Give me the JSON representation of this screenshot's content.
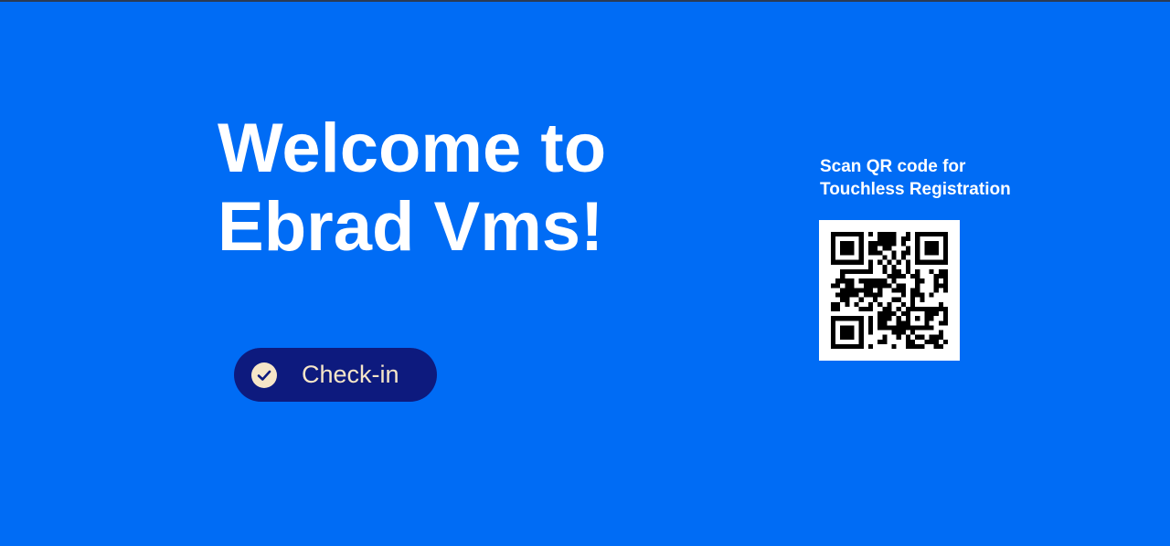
{
  "welcome": {
    "line1": "Welcome to",
    "line2": "Ebrad Vms!"
  },
  "checkin_button": {
    "label": "Check-in",
    "icon": "check-circle-icon"
  },
  "qr": {
    "caption_line1": "Scan QR code for",
    "caption_line2": "Touchless Registration",
    "icon": "qr-code"
  },
  "colors": {
    "background": "#006cf5",
    "button": "#0d1a7e",
    "button_text": "#f6e6c8"
  }
}
